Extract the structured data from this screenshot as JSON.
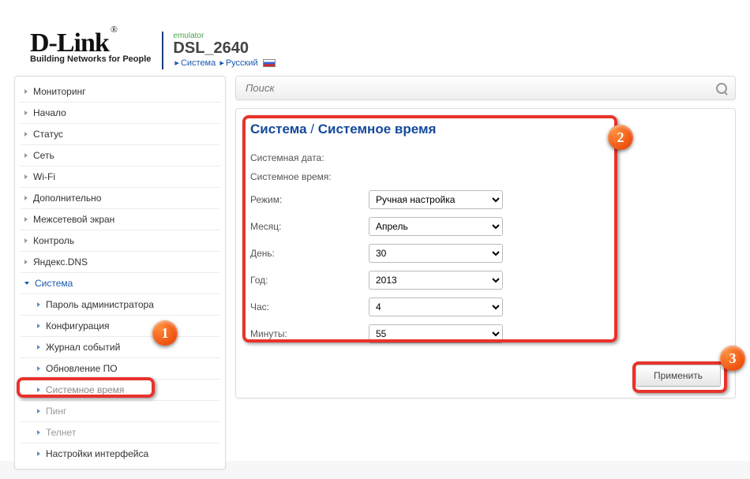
{
  "header": {
    "brand": "D-Link",
    "tagline": "Building Networks for People",
    "emulator": "emulator",
    "model": "DSL_2640",
    "bc1": "Система",
    "bc2": "Русский"
  },
  "sidebar": {
    "items": [
      {
        "label": "Мониторинг"
      },
      {
        "label": "Начало"
      },
      {
        "label": "Статус"
      },
      {
        "label": "Сеть"
      },
      {
        "label": "Wi-Fi"
      },
      {
        "label": "Дополнительно"
      },
      {
        "label": "Межсетевой экран"
      },
      {
        "label": "Контроль"
      },
      {
        "label": "Яндекс.DNS"
      },
      {
        "label": "Система"
      }
    ],
    "sub": [
      {
        "label": "Пароль администратора"
      },
      {
        "label": "Конфигурация"
      },
      {
        "label": "Журнал событий"
      },
      {
        "label": "Обновление ПО"
      },
      {
        "label": "Системное время"
      },
      {
        "label": "Пинг"
      },
      {
        "label": "Телнет"
      },
      {
        "label": "Настройки интерфейса"
      }
    ]
  },
  "search": {
    "placeholder": "Поиск"
  },
  "panel": {
    "title_a": "Система",
    "title_sep": "/",
    "title_b": "Системное время",
    "rows": {
      "sysdate": "Системная дата:",
      "systime": "Системное время:",
      "mode": "Режим:",
      "month": "Месяц:",
      "day": "День:",
      "year": "Год:",
      "hour": "Час:",
      "minute": "Минуты:"
    },
    "values": {
      "mode": "Ручная настройка",
      "month": "Апрель",
      "day": "30",
      "year": "2013",
      "hour": "4",
      "minute": "55"
    },
    "apply": "Применить"
  },
  "annotations": {
    "b1": "1",
    "b2": "2",
    "b3": "3"
  }
}
